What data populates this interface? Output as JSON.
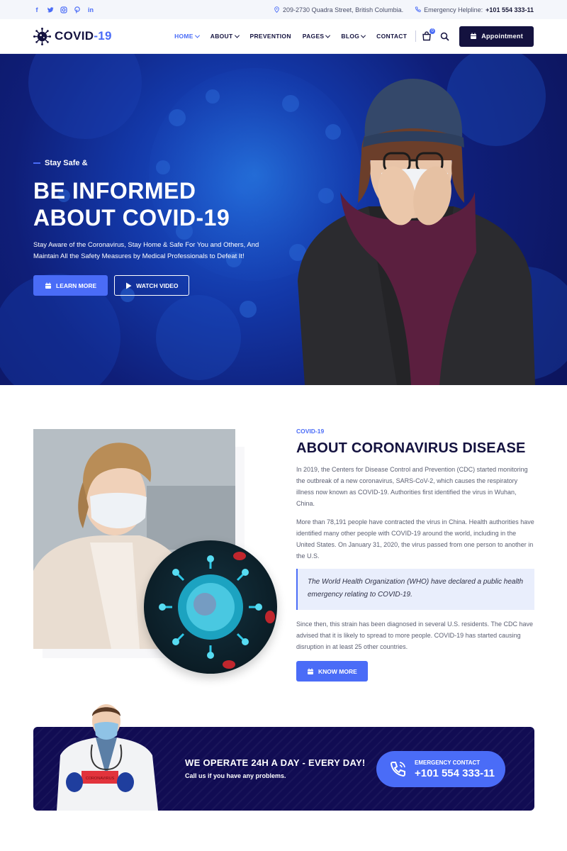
{
  "topbar": {
    "social": [
      "f",
      "t",
      "ig",
      "p",
      "in"
    ],
    "address": "209-2730 Quadra Street, British Columbia.",
    "helpline_label": "Emergency Helpline:",
    "helpline_number": "+101 554 333-11"
  },
  "nav": {
    "logo_text": "COVID",
    "logo_accent": "-19",
    "items": [
      "HOME",
      "ABOUT",
      "PREVENTION",
      "PAGES",
      "BLOG",
      "CONTACT"
    ],
    "cart_count": "0",
    "appointment_label": "Appointment"
  },
  "hero": {
    "kicker": "Stay Safe &",
    "title_line1": "BE INFORMED",
    "title_line2": "ABOUT COVID-19",
    "description": "Stay Aware of the Coronavirus, Stay Home & Safe For You and Others, And Maintain All the Safety Measures by Medical Professionals to Defeat It!",
    "learn_more": "LEARN MORE",
    "watch_video": "WATCH VIDEO"
  },
  "about": {
    "eyebrow": "COVID-19",
    "title": "ABOUT CORONAVIRUS DISEASE",
    "para1": "In 2019, the Centers for Disease Control and Prevention (CDC) started monitoring the outbreak of a new coronavirus, SARS-CoV-2, which causes the respiratory illness now known as COVID-19. Authorities first identified the virus in Wuhan, China.",
    "para2": "More than 78,191 people have contracted the virus in China. Health authorities have identified many other people with COVID-19 around the world, including in the United States. On January 31, 2020, the virus passed from one person to another in the U.S.",
    "quote": "The World Health Organization (WHO) have declared a public health emergency relating to COVID-19.",
    "para3": "Since then, this strain has been diagnosed in several U.S. residents. The CDC have advised that it is likely to spread to more people. COVID-19 has started causing disruption in at least 25 other countries.",
    "button": "KNOW MORE"
  },
  "banner": {
    "title": "WE OPERATE 24H A DAY - EVERY DAY!",
    "subtitle": "Call us if you have any problems.",
    "emergency_label": "EMERGENCY CONTACT",
    "emergency_number": "+101 554 333-11",
    "sign_text": "CORONAVIRUS"
  },
  "colors": {
    "accent": "#4a6cf7",
    "navy": "#14123f",
    "banner": "#110c53"
  }
}
